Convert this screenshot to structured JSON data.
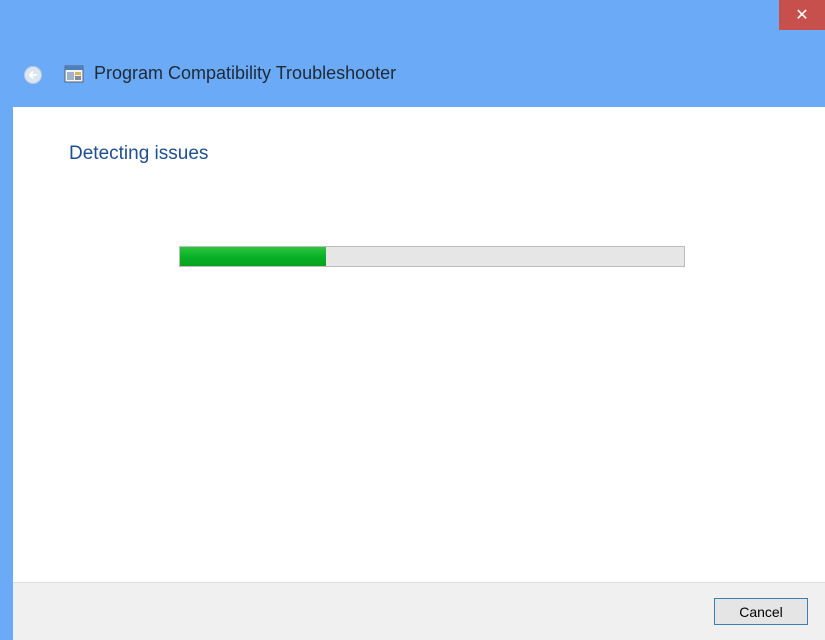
{
  "window": {
    "title": "Program Compatibility Troubleshooter",
    "close_glyph": "✕",
    "back_icon": "back-arrow-icon",
    "app_icon": "troubleshooter-icon",
    "titlebar_color": "#6aaaf6",
    "close_color": "#c7504c"
  },
  "main": {
    "heading": "Detecting issues",
    "heading_color": "#1e4f91",
    "progress": {
      "percent": 29,
      "fill_color": "#06b025"
    }
  },
  "footer": {
    "cancel_label": "Cancel"
  }
}
